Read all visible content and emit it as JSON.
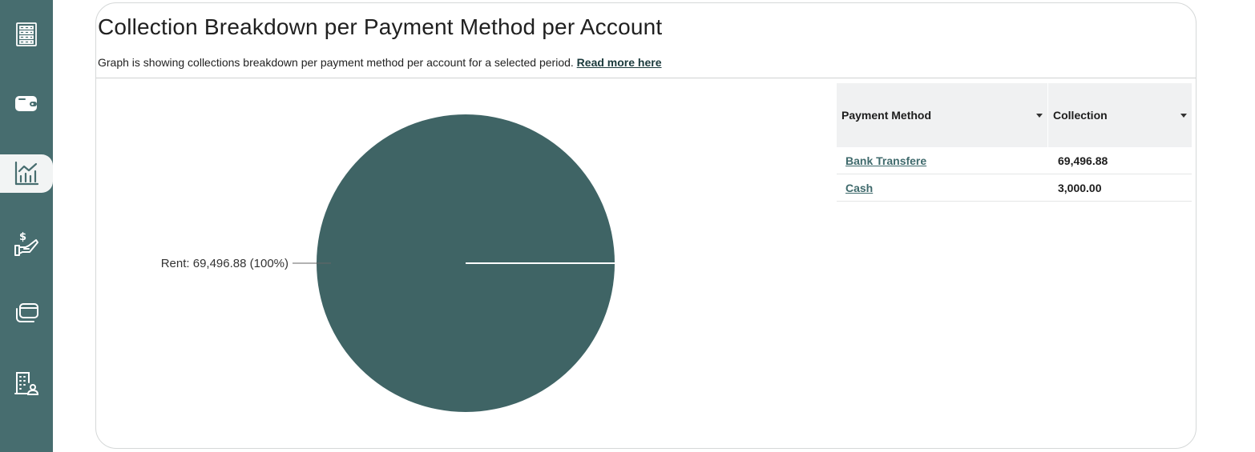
{
  "sidebar": {
    "items": [
      {
        "icon": "building-icon",
        "active": false
      },
      {
        "icon": "wallet-icon",
        "active": false
      },
      {
        "icon": "chart-icon",
        "active": true
      },
      {
        "icon": "payment-hand-icon",
        "active": false
      },
      {
        "icon": "cards-icon",
        "active": false
      },
      {
        "icon": "building-user-icon",
        "active": false
      }
    ]
  },
  "card": {
    "title": "Collection Breakdown per Payment Method per Account",
    "description": "Graph is showing collections breakdown per payment method per account for a selected period.",
    "read_more": "Read more here"
  },
  "table": {
    "headers": [
      "Payment Method",
      "Collection"
    ],
    "rows": [
      {
        "method": "Bank Transfere",
        "collection": "69,496.88"
      },
      {
        "method": "Cash",
        "collection": "3,000.00"
      }
    ]
  },
  "chart_data": {
    "type": "pie",
    "slices": [
      {
        "label": "Rent",
        "value": 69496.88,
        "percent": 100,
        "color": "#3f6465"
      }
    ],
    "data_labels": [
      "Rent: 69,496.88 (100%)"
    ]
  },
  "colors": {
    "sidebar": "#476d6f",
    "pie": "#3f6465",
    "link": "#3f6a6c"
  }
}
